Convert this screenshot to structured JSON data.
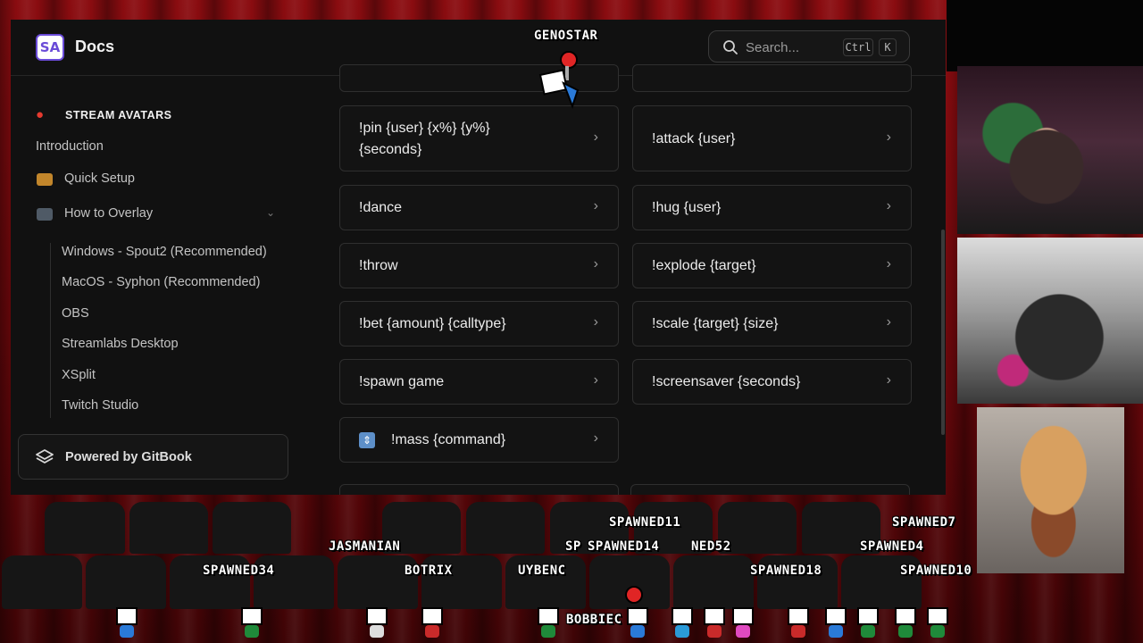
{
  "docs": {
    "title": "Docs",
    "search": {
      "placeholder": "Search...",
      "kbd_ctrl": "Ctrl",
      "kbd_k": "K"
    },
    "sidebar": {
      "section_title": "STREAM AVATARS",
      "items": [
        {
          "label": "Introduction"
        },
        {
          "label": "Quick Setup"
        },
        {
          "label": "How to Overlay"
        }
      ],
      "subitems": [
        {
          "label": "Windows - Spout2 (Recommended)"
        },
        {
          "label": "MacOS - Syphon (Recommended)"
        },
        {
          "label": "OBS"
        },
        {
          "label": "Streamlabs Desktop"
        },
        {
          "label": "XSplit"
        },
        {
          "label": "Twitch Studio"
        }
      ],
      "powered_by": "Powered by GitBook"
    },
    "commands": [
      {
        "label": "!pin {user} {x%} {y%} {seconds}"
      },
      {
        "label": "!attack {user}"
      },
      {
        "label": "!dance"
      },
      {
        "label": "!hug {user}"
      },
      {
        "label": "!throw"
      },
      {
        "label": "!explode {target}"
      },
      {
        "label": "!bet {amount} {calltype}"
      },
      {
        "label": "!scale {target} {size}"
      },
      {
        "label": "!spawn game"
      },
      {
        "label": "!screensaver {seconds}"
      },
      {
        "label": "!mass {command}"
      }
    ]
  },
  "overlay": {
    "names": {
      "genostar": "GENOSTAR",
      "spawned11": "SPAWNED11",
      "spawned7": "SPAWNED7",
      "jasmanian": "JASMANIAN",
      "sp": "SP",
      "spawned14": "SPAWNED14",
      "ned52": "NED52",
      "spawned4": "SPAWNED4",
      "spawned34": "SPAWNED34",
      "botrix": "BOTRIX",
      "uybenc": "UYBENC",
      "spawned18": "SPAWNED18",
      "spawned10": "SPAWNED10",
      "bobbiec": "BOBBIEC"
    }
  },
  "colors": {
    "accent": "#6a4bd8",
    "panel_bg": "#111111",
    "curtain_red": "#8a0c10"
  }
}
